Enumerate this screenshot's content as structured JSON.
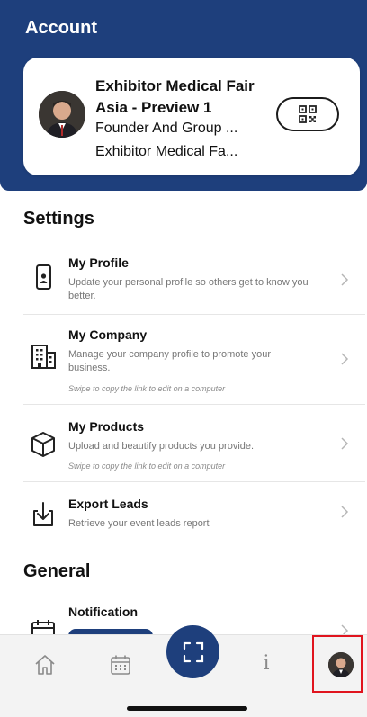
{
  "header": {
    "title": "Account"
  },
  "profile_card": {
    "name": "Exhibitor Medical Fair Asia - Preview 1",
    "role": "Founder And Group ...",
    "company": "Exhibitor Medical Fa...",
    "qr_icon": "qr-code-icon"
  },
  "settings": {
    "title": "Settings",
    "items": [
      {
        "title": "My Profile",
        "desc": "Update your personal profile so others get to know you better.",
        "hint": "",
        "icon": "phone-profile-icon"
      },
      {
        "title": "My Company",
        "desc": "Manage your company profile to promote your business.",
        "hint": "Swipe to copy the link to edit on a computer",
        "icon": "building-icon"
      },
      {
        "title": "My Products",
        "desc": "Upload and beautify products you provide.",
        "hint": "Swipe to copy the link to edit on a computer",
        "icon": "box-icon"
      },
      {
        "title": "Export Leads",
        "desc": "Retrieve your event leads report",
        "hint": "",
        "icon": "download-icon"
      }
    ]
  },
  "general": {
    "title": "General",
    "items": [
      {
        "title": "Notification",
        "icon": "calendar-icon"
      }
    ]
  },
  "tabbar": {
    "items": [
      "home-icon",
      "calendar-icon",
      "scan-icon",
      "info-icon",
      "avatar"
    ],
    "info_glyph": "i"
  },
  "colors": {
    "primary": "#1e3f7c",
    "highlight": "#e0141e"
  }
}
